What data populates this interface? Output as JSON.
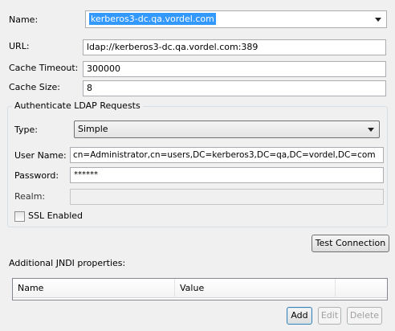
{
  "form": {
    "name_label": "Name:",
    "name_value": "kerberos3-dc.qa.vordel.com",
    "url_label": "URL:",
    "url_value": "ldap://kerberos3-dc.qa.vordel.com:389",
    "cache_timeout_label": "Cache Timeout:",
    "cache_timeout_value": "300000",
    "cache_size_label": "Cache Size:",
    "cache_size_value": "8"
  },
  "auth_group": {
    "title": "Authenticate LDAP Requests",
    "type_label": "Type:",
    "type_value": "Simple",
    "username_label": "User Name:",
    "username_value": "cn=Administrator,cn=users,DC=kerberos3,DC=qa,DC=vordel,DC=com",
    "password_label": "Password:",
    "password_value": "******",
    "realm_label": "Realm:",
    "realm_value": "",
    "ssl_label": "SSL Enabled",
    "ssl_checked": false
  },
  "test_connection_label": "Test Connection",
  "jndi": {
    "title": "Additional JNDI properties:",
    "columns": [
      "Name",
      "Value"
    ],
    "rows": []
  },
  "buttons": {
    "add": "Add",
    "edit": "Edit",
    "delete": "Delete"
  }
}
